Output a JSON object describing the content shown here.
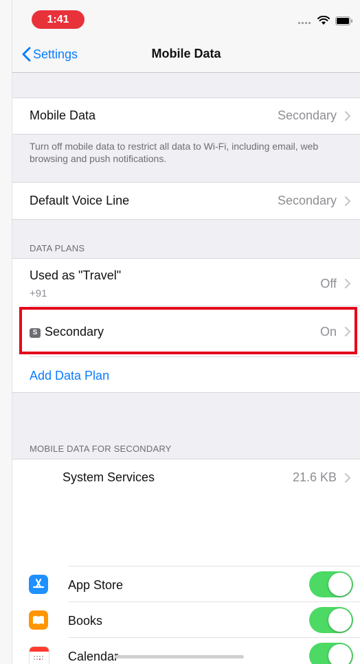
{
  "status_bar": {
    "time": "1:41",
    "icons": [
      "cellular-signal-icon",
      "wifi-icon",
      "battery-icon"
    ]
  },
  "nav": {
    "back_label": "Settings",
    "title": "Mobile Data"
  },
  "mobile_data_row": {
    "label": "Mobile Data",
    "value": "Secondary"
  },
  "mobile_data_footer": "Turn off mobile data to restrict all data to Wi-Fi, including email, web browsing and push notifications.",
  "voice_line_row": {
    "label": "Default Voice Line",
    "value": "Secondary"
  },
  "data_plans": {
    "header": "DATA PLANS",
    "plans": [
      {
        "label": "Used as \"Travel\"",
        "sublabel": "+91",
        "value": "Off"
      },
      {
        "badge": "S",
        "label": "Secondary",
        "value": "On"
      }
    ],
    "add_label": "Add Data Plan"
  },
  "usage": {
    "header": "MOBILE DATA FOR SECONDARY",
    "system_services": {
      "label": "System Services",
      "value": "21.6 KB"
    },
    "apps": [
      {
        "label": "App Store",
        "on": true,
        "color": "#1e90ff"
      },
      {
        "label": "Books",
        "on": true,
        "color": "#ff9500"
      },
      {
        "label": "Calendar",
        "on": true,
        "color": "#ffffff"
      }
    ]
  },
  "colors": {
    "accent": "#0a7cff",
    "toggle_on": "#4cd964",
    "time_pill": "#e8323a",
    "highlight": "#e4061b"
  }
}
